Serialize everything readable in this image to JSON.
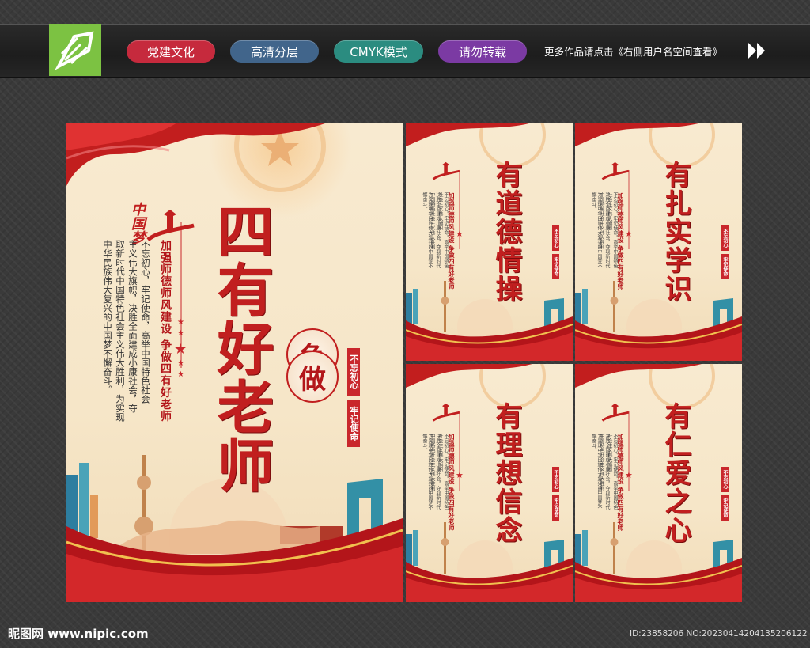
{
  "header": {
    "tags": [
      {
        "label": "党建文化",
        "color": "#c62a3d"
      },
      {
        "label": "高清分层",
        "color": "#41658b"
      },
      {
        "label": "CMYK模式",
        "color": "#2b8c80"
      },
      {
        "label": "请勿转载",
        "color": "#7b3aa3"
      }
    ],
    "note": "更多作品请点击《右侧用户名空间查看》"
  },
  "main_poster": {
    "title": "四有好老师",
    "circle_chars": [
      "争",
      "做"
    ],
    "seal_left": "不忘初心",
    "seal_right": "牢记使命",
    "subtitle": "加强师德师风建设 争做四有好老师",
    "body_lines": [
      "不忘初心，牢记使命，高举中国特色社会",
      "主义伟大旗帜，决胜全面建成小康社会，夺",
      "取新时代中国特色社会主义伟大胜利，为实现",
      "中华民族伟大复兴的中国梦不懈奋斗。"
    ],
    "logo_text": "中国梦"
  },
  "small_posters": [
    {
      "title": "有道德情操"
    },
    {
      "title": "有扎实学识"
    },
    {
      "title": "有理想信念"
    },
    {
      "title": "有仁爱之心"
    }
  ],
  "small_common": {
    "subtitle": "加强师德师风建设 争做四有好老师",
    "seal_left": "不忘初心",
    "seal_right": "牢记使命",
    "body_lines": [
      "不忘初心，牢记使命，高举中国特色社会主义伟大旗帜",
      "决胜全面建成小康社会，夺取新时代中国特色社会主义伟大胜利",
      "为实现中华民族伟大复兴的中国梦不懈奋斗。"
    ]
  },
  "footer": {
    "site": "昵图网 www.nipic.com",
    "id": "ID:23858206 NO:20230414204135206122"
  }
}
